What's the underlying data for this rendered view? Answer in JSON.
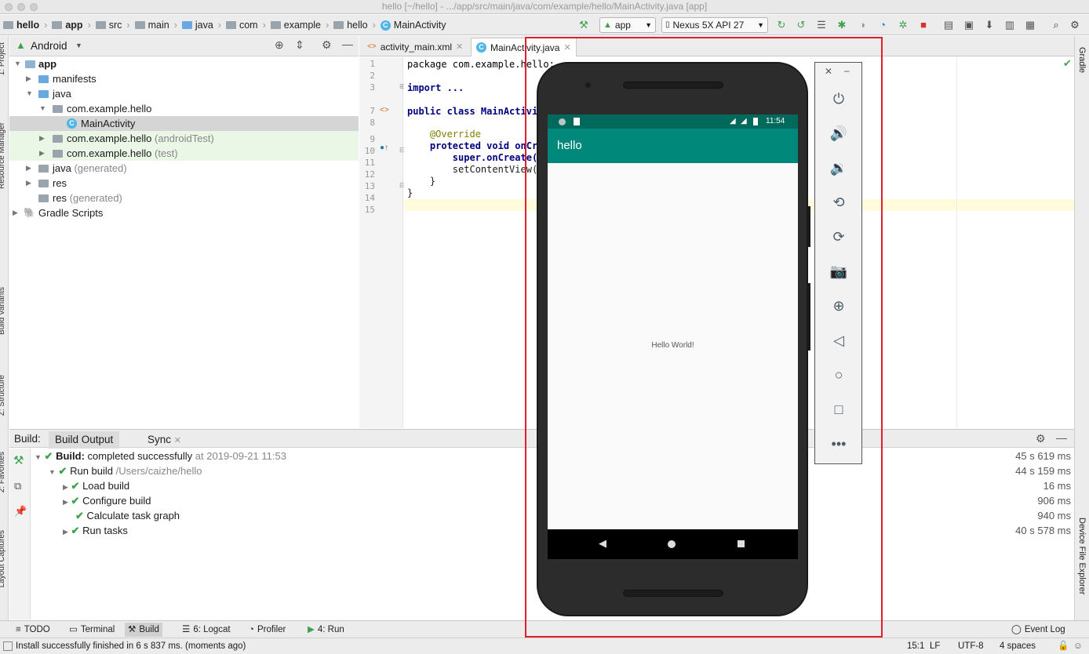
{
  "window": {
    "title": "hello [~/hello] - .../app/src/main/java/com/example/hello/MainActivity.java [app]"
  },
  "breadcrumb": [
    "hello",
    "app",
    "src",
    "main",
    "java",
    "com",
    "example",
    "hello",
    "MainActivity"
  ],
  "toolbar": {
    "run_config": "app",
    "device": "Nexus 5X API 27"
  },
  "side_tools": {
    "project": "1: Project",
    "resource_manager": "Resource Manager",
    "build_variants": "Build Variants",
    "structure": "Z: Structure",
    "favorites": "2: Favorites",
    "layout_captures": "Layout Captures",
    "gradle": "Gradle",
    "device_file_explorer": "Device File Explorer"
  },
  "project": {
    "view": "Android",
    "tree": [
      {
        "label": "app",
        "extra": "",
        "icon": "app-module-icon"
      },
      {
        "label": "manifests",
        "extra": "",
        "icon": "folder-icon"
      },
      {
        "label": "java",
        "extra": "",
        "icon": "folder-icon"
      },
      {
        "label": "com.example.hello",
        "extra": "",
        "icon": "package-icon"
      },
      {
        "label": "MainActivity",
        "extra": "",
        "icon": "class-icon"
      },
      {
        "label": "com.example.hello",
        "extra": " (androidTest)",
        "icon": "package-icon"
      },
      {
        "label": "com.example.hello",
        "extra": " (test)",
        "icon": "package-icon"
      },
      {
        "label": "java",
        "extra": " (generated)",
        "icon": "folder-icon"
      },
      {
        "label": "res",
        "extra": "",
        "icon": "folder-icon"
      },
      {
        "label": "res",
        "extra": " (generated)",
        "icon": "folder-icon"
      },
      {
        "label": "Gradle Scripts",
        "extra": "",
        "icon": "gradle-icon"
      }
    ]
  },
  "editor": {
    "tabs": [
      {
        "label": "activity_main.xml"
      },
      {
        "label": "MainActivity.java"
      }
    ],
    "line_numbers": [
      "1",
      "2",
      "3",
      "7",
      "8",
      "9",
      "10",
      "11",
      "12",
      "13",
      "14",
      "15"
    ],
    "lines": [
      "package com.example.hello;",
      "",
      "import ...",
      "public class MainActivi",
      "",
      "    @Override",
      "    protected void onCre",
      "        super.onCreate(s",
      "        setContentView(R",
      "    }",
      "}",
      ""
    ]
  },
  "build": {
    "label": "Build:",
    "tabs": [
      "Build Output",
      "Sync"
    ],
    "rows": [
      {
        "bold": "Build:",
        "text": " completed successfully",
        "extra": " at 2019-09-21 11:53",
        "time": "45 s 619 ms"
      },
      {
        "bold": "",
        "text": "Run build",
        "extra": " /Users/caizhe/hello",
        "time": "44 s 159 ms"
      },
      {
        "bold": "",
        "text": "Load build",
        "extra": "",
        "time": "16 ms"
      },
      {
        "bold": "",
        "text": "Configure build",
        "extra": "",
        "time": "906 ms"
      },
      {
        "bold": "",
        "text": "Calculate task graph",
        "extra": "",
        "time": "940 ms"
      },
      {
        "bold": "",
        "text": "Run tasks",
        "extra": "",
        "time": "40 s 578 ms"
      }
    ]
  },
  "bottom_tools": [
    "TODO",
    "Terminal",
    "Build",
    "6: Logcat",
    "Profiler",
    "4: Run"
  ],
  "event_log": "Event Log",
  "status": {
    "message": "Install successfully finished in 6 s 837 ms. (moments ago)",
    "position": "15:1",
    "line_sep": "LF",
    "encoding": "UTF-8",
    "indent": "4 spaces"
  },
  "emulator": {
    "time": "11:54",
    "app_title": "hello",
    "content": "Hello World!"
  },
  "colors": {
    "accent_red": "#e0202a",
    "app_bar": "#00897b",
    "status_bar": "#00695c",
    "success": "#3fa34d"
  }
}
